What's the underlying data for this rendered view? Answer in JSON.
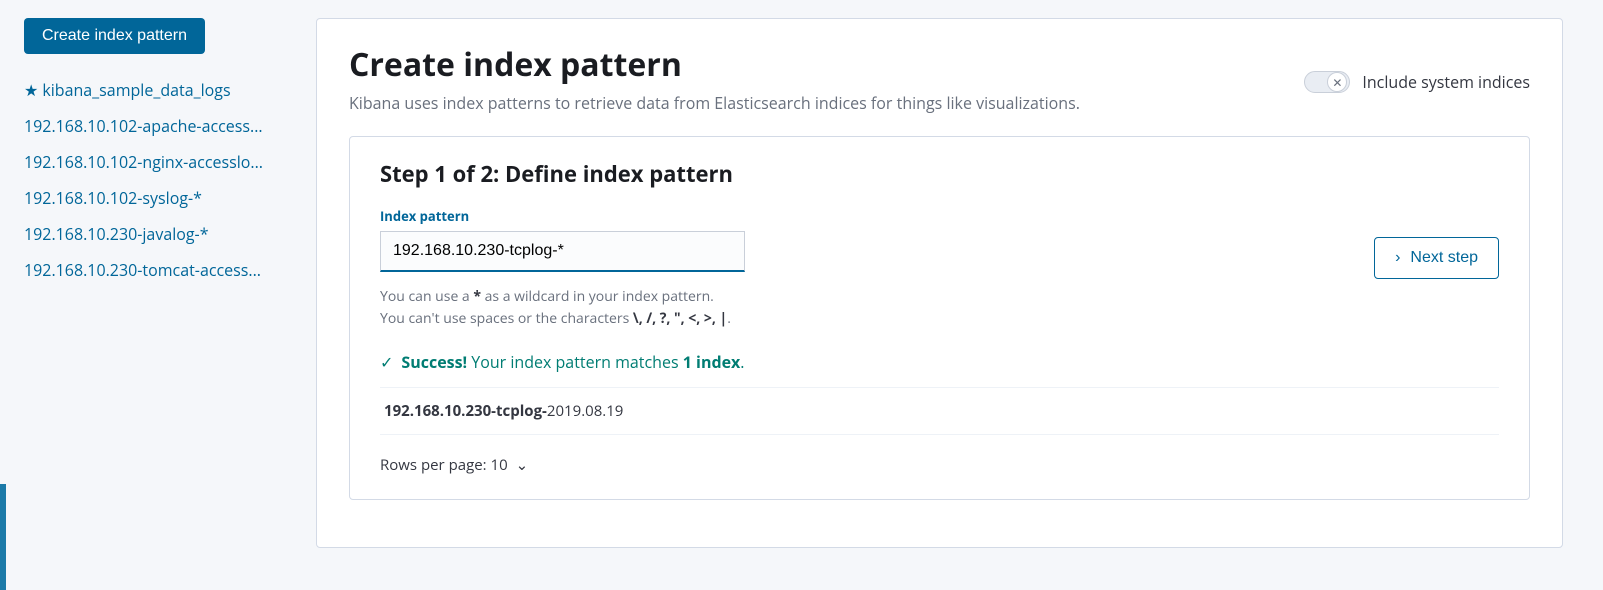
{
  "sidebar": {
    "create_btn": "Create index pattern",
    "items": [
      {
        "label": "kibana_sample_data_logs",
        "starred": true
      },
      {
        "label": "192.168.10.102-apache-access...",
        "starred": false
      },
      {
        "label": "192.168.10.102-nginx-accesslo...",
        "starred": false
      },
      {
        "label": "192.168.10.102-syslog-*",
        "starred": false
      },
      {
        "label": "192.168.10.230-javalog-*",
        "starred": false
      },
      {
        "label": "192.168.10.230-tomcat-access...",
        "starred": false
      }
    ]
  },
  "header": {
    "title": "Create index pattern",
    "desc": "Kibana uses index patterns to retrieve data from Elasticsearch indices for things like visualizations.",
    "toggle_label": "Include system indices",
    "toggle_on": false
  },
  "step": {
    "title": "Step 1 of 2: Define index pattern",
    "field_label": "Index pattern",
    "input_value": "192.168.10.230-tcplog-*",
    "help_line1_pre": "You can use a ",
    "help_line1_b": "*",
    "help_line1_post": " as a wildcard in your index pattern.",
    "help_line2_pre": "You can't use spaces or the characters ",
    "help_line2_b": "\\, /, ?, \", <, >, |",
    "help_line2_post": ".",
    "next_btn": "Next step",
    "success_check": "✓",
    "success_bold1": "Success!",
    "success_mid": " Your index pattern matches ",
    "success_bold2": "1 index",
    "success_end": ".",
    "match_bold": "192.168.10.230-tcplog-",
    "match_tail": "2019.08.19",
    "rows_label": "Rows per page: 10"
  }
}
